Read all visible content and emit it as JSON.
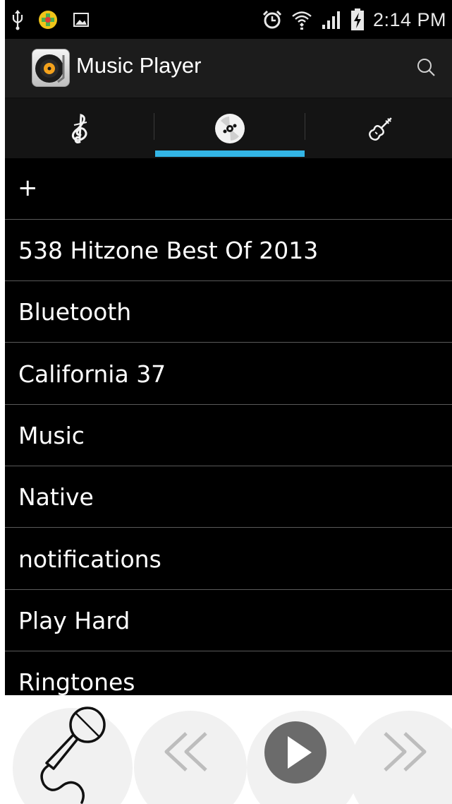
{
  "status_bar": {
    "time": "2:14 PM",
    "left_icons": [
      "usb-icon",
      "app-notification-icon",
      "picture-icon"
    ],
    "right_icons": [
      "alarm-icon",
      "wifi-icon",
      "signal-icon",
      "battery-charging-icon"
    ]
  },
  "action_bar": {
    "title": "Music Player",
    "app_icon": "music-player-app-icon",
    "search_icon": "search-icon"
  },
  "tabs": {
    "items": [
      {
        "icon": "treble-clef-icon",
        "name": "songs"
      },
      {
        "icon": "disc-icon",
        "name": "playlists"
      },
      {
        "icon": "violin-icon",
        "name": "genres"
      }
    ],
    "selected_index": 1,
    "accent_color": "#33b5e5"
  },
  "playlist": {
    "add_label": "+",
    "items": [
      "538 Hitzone Best Of 2013",
      "Bluetooth",
      "California 37",
      "Music",
      "Native",
      "notifications",
      "Play Hard",
      "Ringtones"
    ]
  },
  "player_bar": {
    "icons": [
      "microphone-icon",
      "previous-icon",
      "play-icon",
      "next-icon"
    ]
  }
}
